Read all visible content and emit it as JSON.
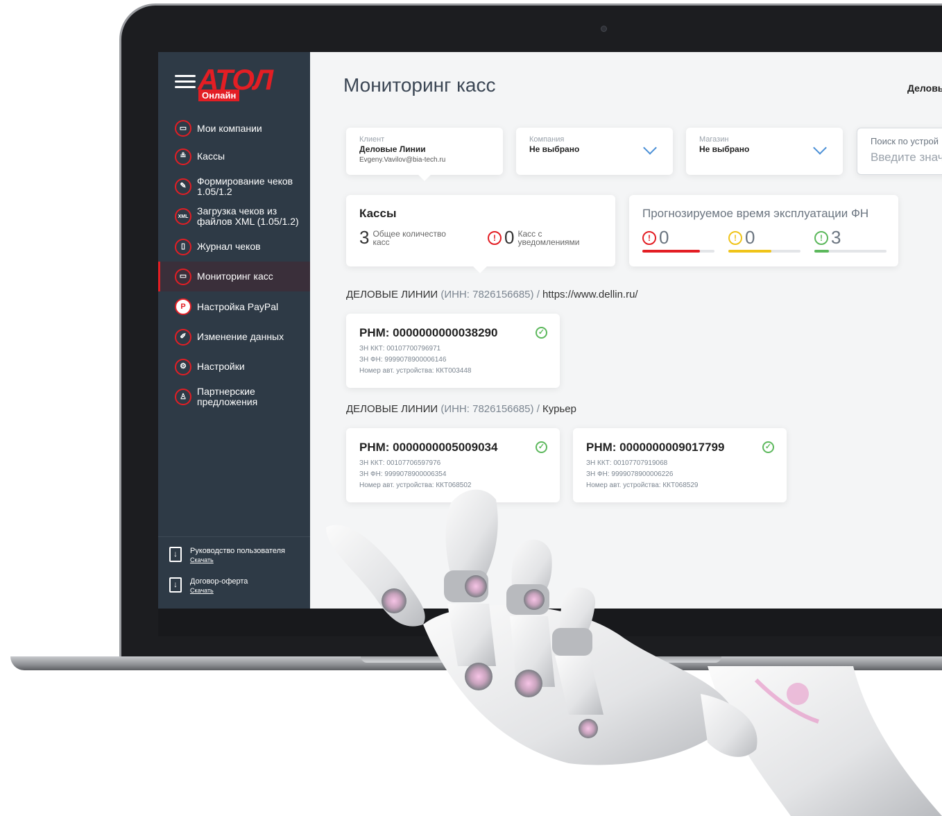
{
  "brand": {
    "logo_text": "АТОЛ",
    "badge": "Онлайн"
  },
  "sidebar": {
    "items": [
      {
        "label": "Мои компании",
        "icon": "company-icon"
      },
      {
        "label": "Кассы",
        "icon": "cashbox-icon"
      },
      {
        "label": "Формирование чеков 1.05/1.2",
        "icon": "receipt-edit-icon"
      },
      {
        "label": "Загрузка чеков из файлов XML (1.05/1.2)",
        "icon": "xml-upload-icon"
      },
      {
        "label": "Журнал чеков",
        "icon": "journal-icon"
      },
      {
        "label": "Мониторинг касс",
        "icon": "monitor-icon",
        "active": true
      },
      {
        "label": "Настройка PayPal",
        "icon": "paypal-icon"
      },
      {
        "label": "Изменение данных",
        "icon": "edit-icon"
      },
      {
        "label": "Настройки",
        "icon": "gear-icon"
      },
      {
        "label": "Партнерские предложения",
        "icon": "partner-icon"
      }
    ],
    "docs": [
      {
        "title": "Руководство пользователя",
        "link": "Скачать"
      },
      {
        "title": "Договор-оферта",
        "link": "Скачать"
      }
    ]
  },
  "header": {
    "title": "Мониторинг касс",
    "user": "Деловы"
  },
  "filters": {
    "client": {
      "label": "Клиент",
      "value": "Деловые Линии",
      "email": "Evgeny.Vavilov@bia-tech.ru"
    },
    "company": {
      "label": "Компания",
      "value": "Не выбрано"
    },
    "shop": {
      "label": "Магазин",
      "value": "Не выбрано"
    },
    "search": {
      "label": "Поиск по устрой",
      "placeholder": "Введите знач"
    }
  },
  "kassy": {
    "title": "Кассы",
    "total": "3",
    "total_label": "Общее количество касс",
    "alerts": "0",
    "alerts_label": "Касс с уведомлениями"
  },
  "fn": {
    "title": "Прогнозируемое время эксплуатации ФН",
    "items": [
      {
        "value": "0",
        "color": "#e31e24",
        "fill": 0.8
      },
      {
        "value": "0",
        "color": "#f0c419",
        "fill": 0.6
      },
      {
        "value": "3",
        "color": "#5cb85c",
        "fill": 0.2
      }
    ]
  },
  "groups": [
    {
      "org": "ДЕЛОВЫЕ ЛИНИИ",
      "inn": "(ИНН: 7826156685) /",
      "place": "https://www.dellin.ru/",
      "devices": [
        {
          "rnm": "РНМ: 0000000000038290",
          "zn_kkt": "ЗН ККТ: 00107700796971",
          "zn_fn": "ЗН ФН: 9999078900006146",
          "auto": "Номер авт. устройства: ККТ003448"
        }
      ]
    },
    {
      "org": "ДЕЛОВЫЕ ЛИНИИ",
      "inn": "(ИНН: 7826156685) /",
      "place": "Курьер",
      "devices": [
        {
          "rnm": "РНМ: 0000000005009034",
          "zn_kkt": "ЗН ККТ: 00107706597976",
          "zn_fn": "ЗН ФН: 9999078900006354",
          "auto": "Номер авт. устройства: ККТ068502"
        },
        {
          "rnm": "РНМ: 0000000009017799",
          "zn_kkt": "ЗН ККТ: 00107707919068",
          "zn_fn": "ЗН ФН: 9999078900006226",
          "auto": "Номер авт. устройства: ККТ068529"
        }
      ]
    }
  ]
}
